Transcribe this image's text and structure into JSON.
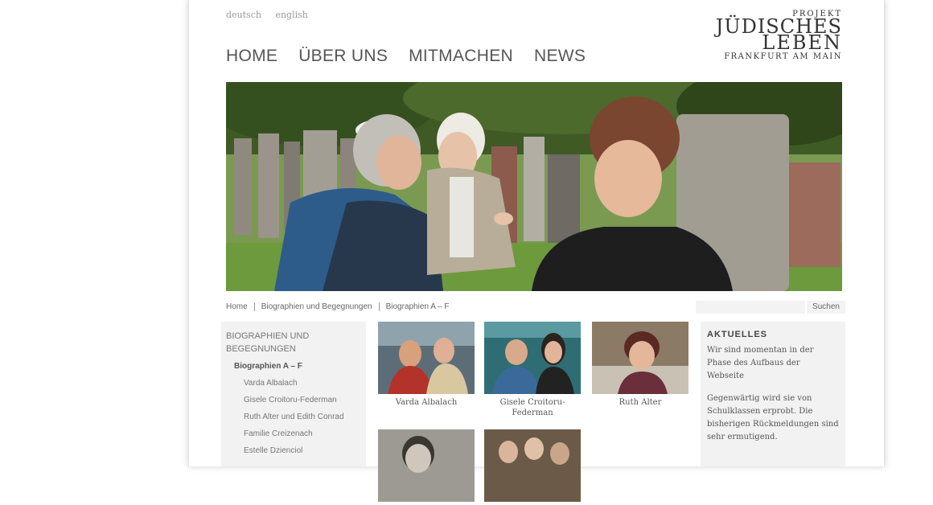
{
  "lang": {
    "de": "deutsch",
    "en": "english"
  },
  "logo": {
    "line1": "PROJEKT",
    "line2": "JÜDISCHES",
    "line3": "LEBEN",
    "line4": "FRANKFURT AM MAIN"
  },
  "nav": [
    "HOME",
    "ÜBER UNS",
    "MITMACHEN",
    "NEWS"
  ],
  "breadcrumb": [
    "Home",
    "Biographien und Begegnungen",
    "Biographien A – F"
  ],
  "search": {
    "button": "Suchen"
  },
  "sidebar": {
    "heading": "BIOGRAPHIEN UND BEGEGNUNGEN",
    "active": "Biographien A – F",
    "items": [
      "Varda Albalach",
      "Gisele Croitoru-Federman",
      "Ruth Alter und Edith Conrad",
      "Familie Creizenach",
      "Estelle Dzienciol"
    ]
  },
  "cards": [
    "Varda Albalach",
    "Gisele Croitoru-Federman",
    "Ruth Alter",
    "",
    ""
  ],
  "aside": {
    "title": "AKTUELLES",
    "p1": "Wir sind momentan in der Phase des Aufbaus der Webseite",
    "p2": "Gegenwärtig wird sie von Schulklassen erprobt. Die bisherigen Rückmeldungen sind sehr ermutigend."
  }
}
